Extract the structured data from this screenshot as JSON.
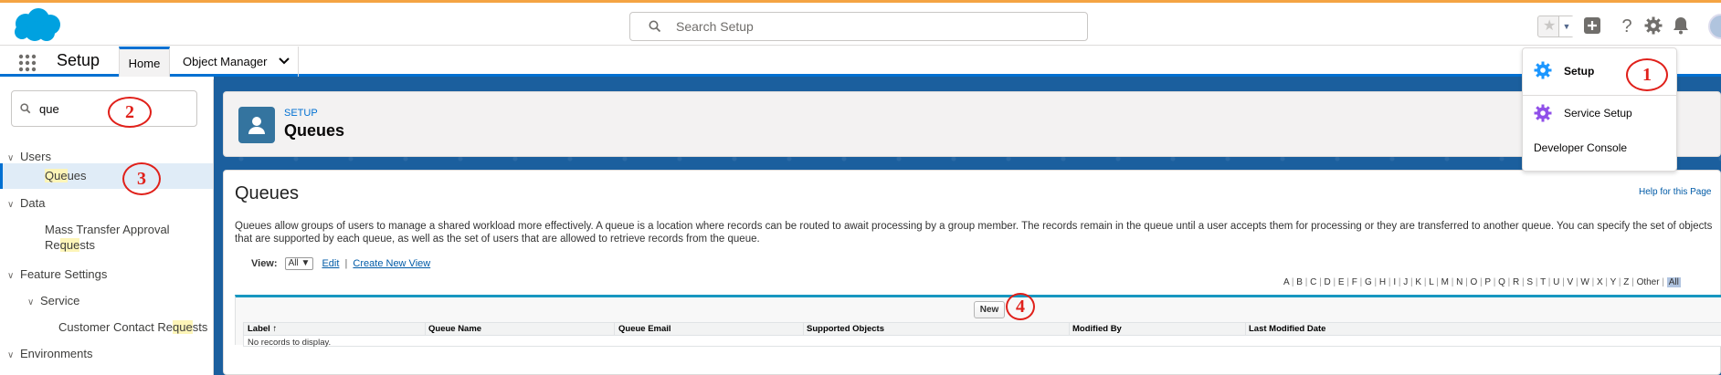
{
  "top_bar": {
    "search_placeholder": "Search Setup",
    "icons": [
      "salesforce-cloud-logo",
      "search-icon",
      "star-icon",
      "add-icon",
      "help-icon",
      "gear-icon",
      "bell-icon",
      "avatar"
    ]
  },
  "nav": {
    "app_name": "Setup",
    "tabs": [
      {
        "label": "Home"
      },
      {
        "label": "Object Manager"
      }
    ]
  },
  "sidebar": {
    "quick_find_value": "que",
    "tree": {
      "users": "Users",
      "queues": "Queues",
      "data": "Data",
      "mass_transfer_line1": "Mass Transfer Approval",
      "mass_transfer_line2": "Requests",
      "feature_settings": "Feature Settings",
      "service": "Service",
      "customer_contact_requests": "Customer Contact Requests",
      "environments": "Environments"
    }
  },
  "header": {
    "subtitle": "SETUP",
    "title": "Queues"
  },
  "content": {
    "title": "Queues",
    "help_link": "Help for this Page",
    "description": "Queues allow groups of users to manage a shared workload more effectively. A queue is a location where records can be routed to await processing by a group member. The records remain in the queue until a user accepts them for processing or they are transferred to another queue. You can specify the set of objects that are supported by each queue, as well as the set of users that are allowed to retrieve records from the queue.",
    "view_label": "View:",
    "view_value": "All",
    "edit_link": "Edit",
    "create_view_link": "Create New View",
    "alpha_filter": [
      "A",
      "B",
      "C",
      "D",
      "E",
      "F",
      "G",
      "H",
      "I",
      "J",
      "K",
      "L",
      "M",
      "N",
      "O",
      "P",
      "Q",
      "R",
      "S",
      "T",
      "U",
      "V",
      "W",
      "X",
      "Y",
      "Z",
      "Other",
      "All"
    ],
    "new_button": "New",
    "columns": [
      "Label",
      "Queue Name",
      "Queue Email",
      "Supported Objects",
      "Modified By",
      "Last Modified Date"
    ],
    "sort_indicator": "↑",
    "empty_message": "No records to display."
  },
  "menu": {
    "items": [
      {
        "label": "Setup"
      },
      {
        "label": "Service Setup"
      },
      {
        "label": "Developer Console"
      }
    ]
  },
  "annotations": [
    "1",
    "2",
    "3",
    "4"
  ],
  "colors": {
    "accent": "#0070d2",
    "annotation": "#e0201a",
    "banner": "#1b5f9e",
    "highlight": "#fdf5b8"
  }
}
